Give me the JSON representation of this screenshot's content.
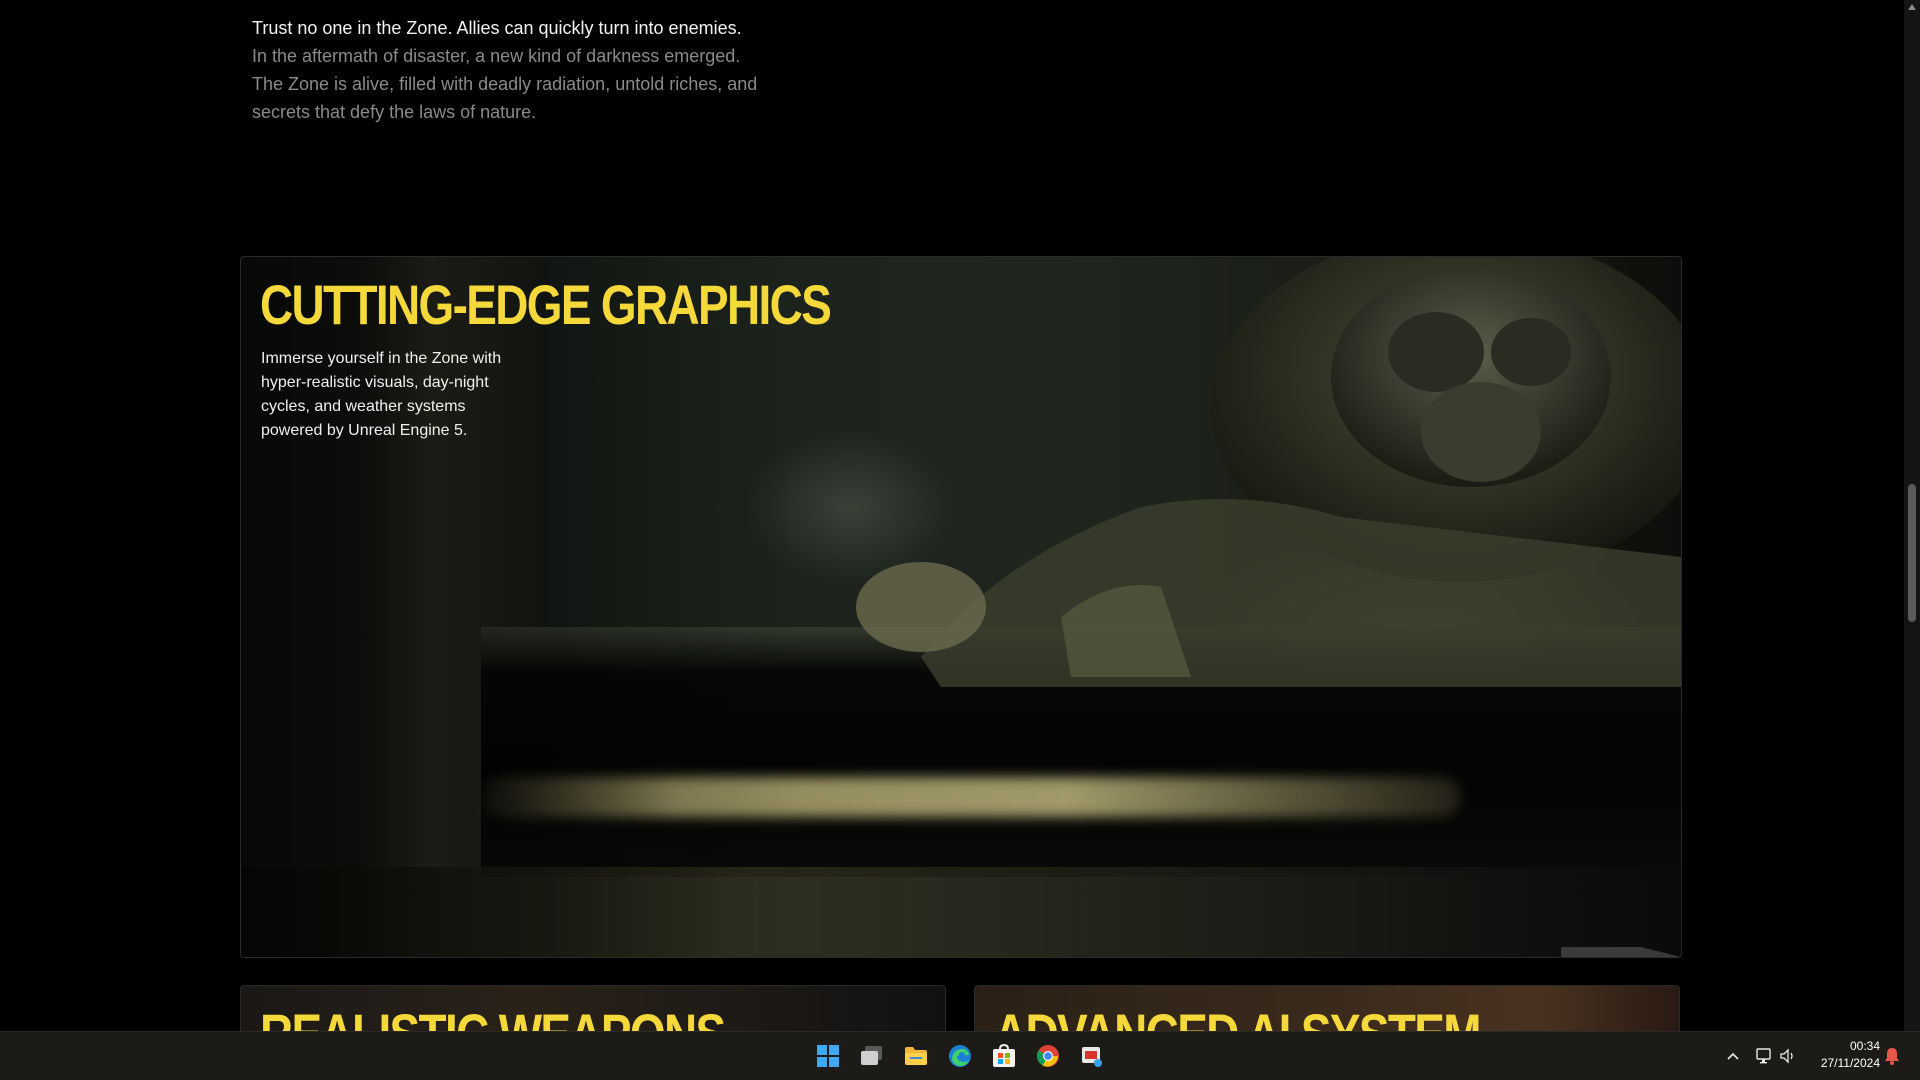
{
  "intro": {
    "lead": "Trust no one in the Zone. Allies can quickly turn into enemies.",
    "body": "In the aftermath of disaster, a new kind of darkness emerged. The Zone is alive, filled with deadly radiation, untold riches, and secrets that defy the laws of nature."
  },
  "feature": {
    "title": "CUTTING-EDGE GRAPHICS",
    "description": "Immerse yourself in the Zone with hyper-realistic visuals, day-night cycles, and weather systems powered by Unreal Engine 5."
  },
  "cards": [
    {
      "title": "REALISTIC WEAPONS"
    },
    {
      "title": "ADVANCED AI SYSTEM"
    }
  ],
  "colors": {
    "accent": "#f5d83a",
    "background": "#000000",
    "taskbar": "#1d1b18"
  },
  "taskbar": {
    "apps": [
      "windows-start-icon",
      "task-view-icon",
      "file-explorer-icon",
      "edge-icon",
      "microsoft-store-icon",
      "chrome-icon",
      "snipping-tool-icon"
    ],
    "tray": [
      "chevron-up-icon",
      "network-icon",
      "volume-icon",
      "notification-icon"
    ],
    "time": "00:34",
    "date": "27/11/2024"
  }
}
